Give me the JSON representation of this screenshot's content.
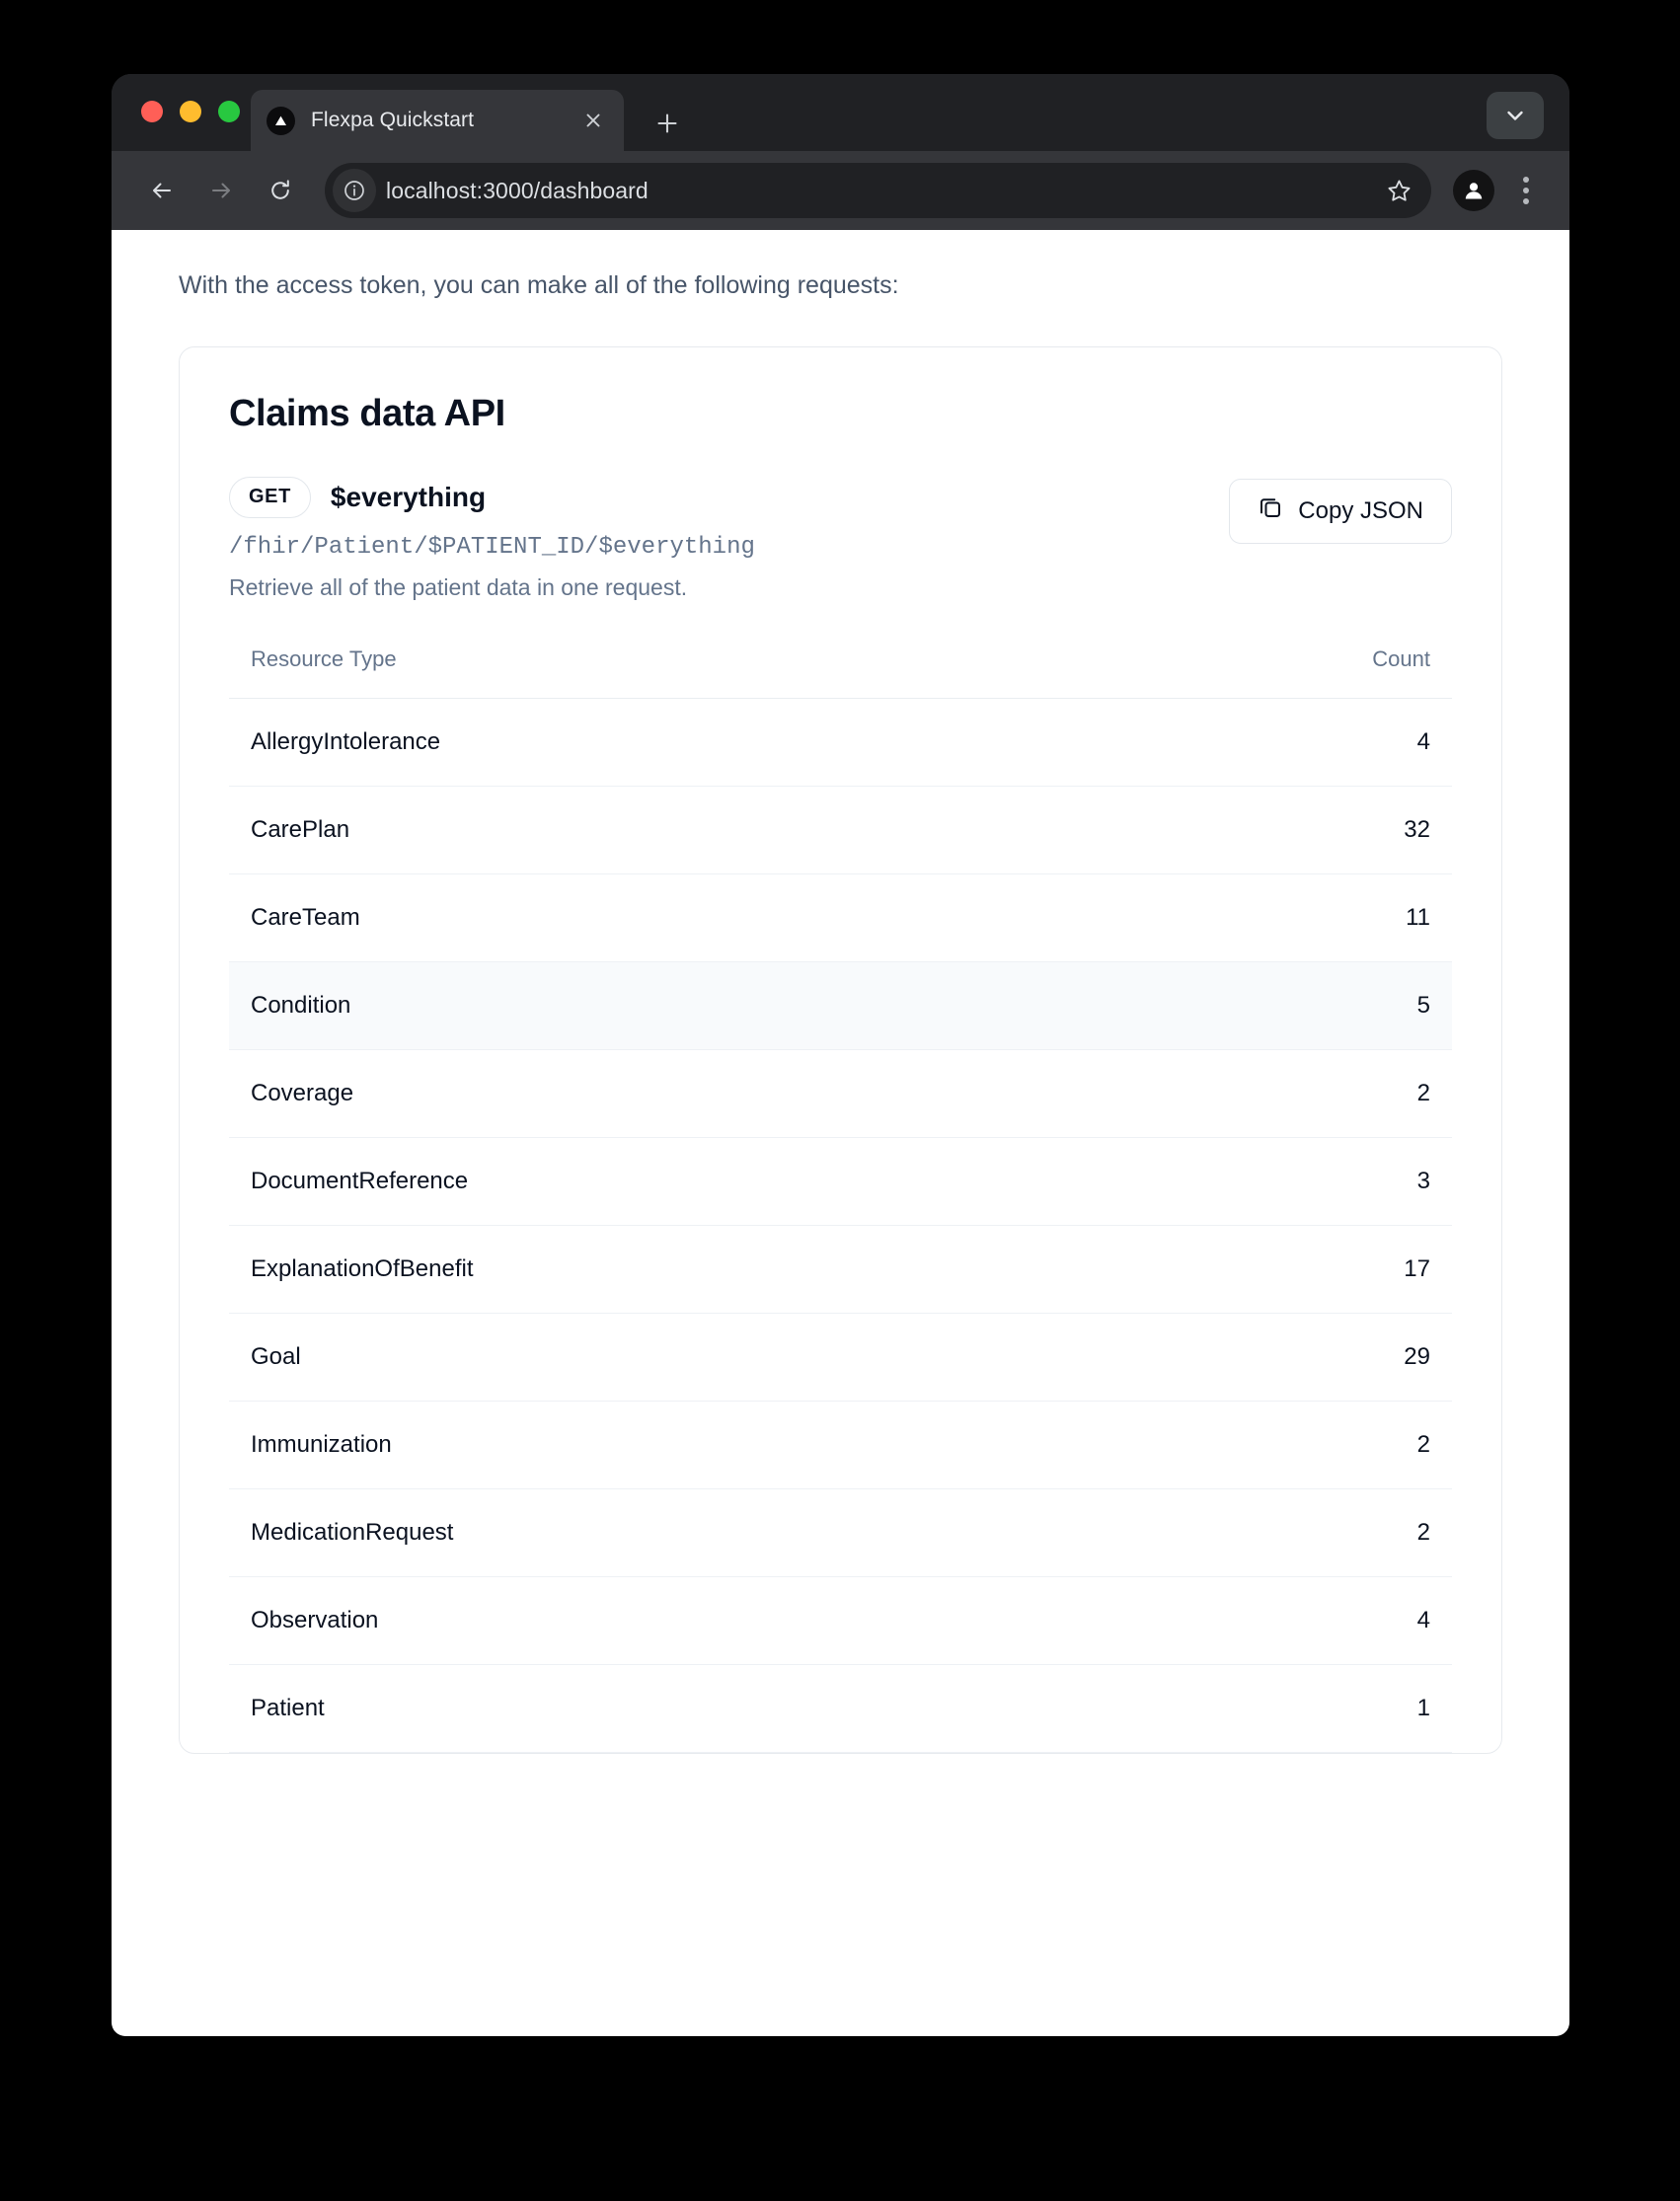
{
  "browser": {
    "tab": {
      "title": "Flexpa Quickstart",
      "favicon_icon": "triangle-logo-icon",
      "close_icon": "close-icon"
    },
    "new_tab_icon": "plus-icon",
    "tab_list_icon": "chevron-down-icon",
    "toolbar": {
      "back_icon": "back-arrow-icon",
      "forward_icon": "forward-arrow-icon",
      "reload_icon": "reload-icon",
      "info_icon": "info-circle-icon",
      "url": "localhost:3000/dashboard",
      "bookmark_icon": "star-icon",
      "profile_icon": "account-avatar-icon",
      "menu_icon": "three-dot-menu-icon"
    },
    "window_controls": {
      "close": "close-window",
      "minimize": "minimize-window",
      "maximize": "maximize-window"
    }
  },
  "page": {
    "intro": "With the access token, you can make all of the following requests:",
    "card": {
      "title": "Claims data API",
      "endpoint": {
        "method": "GET",
        "name": "$everything",
        "path": "/fhir/Patient/$PATIENT_ID/$everything",
        "description": "Retrieve all of the patient data in one request."
      },
      "copy_button": {
        "label": "Copy JSON",
        "icon": "copy-icon"
      },
      "table": {
        "columns": [
          "Resource Type",
          "Count"
        ],
        "rows": [
          {
            "resource": "AllergyIntolerance",
            "count": "4",
            "highlight": false
          },
          {
            "resource": "CarePlan",
            "count": "32",
            "highlight": false
          },
          {
            "resource": "CareTeam",
            "count": "11",
            "highlight": false
          },
          {
            "resource": "Condition",
            "count": "5",
            "highlight": true
          },
          {
            "resource": "Coverage",
            "count": "2",
            "highlight": false
          },
          {
            "resource": "DocumentReference",
            "count": "3",
            "highlight": false
          },
          {
            "resource": "ExplanationOfBenefit",
            "count": "17",
            "highlight": false
          },
          {
            "resource": "Goal",
            "count": "29",
            "highlight": false
          },
          {
            "resource": "Immunization",
            "count": "2",
            "highlight": false
          },
          {
            "resource": "MedicationRequest",
            "count": "2",
            "highlight": false
          },
          {
            "resource": "Observation",
            "count": "4",
            "highlight": false
          },
          {
            "resource": "Patient",
            "count": "1",
            "highlight": false
          }
        ]
      }
    }
  },
  "colors": {
    "chrome_tabstrip": "#202124",
    "chrome_toolbar": "#35363a",
    "omnibox": "#202124",
    "page_background": "#ffffff",
    "text_muted": "#64748b",
    "text_primary": "#0b1220",
    "row_highlight": "#f8fafc",
    "border": "#e9edf1",
    "traffic_red": "#ff5f57",
    "traffic_yellow": "#febc2e",
    "traffic_green": "#28c840"
  }
}
